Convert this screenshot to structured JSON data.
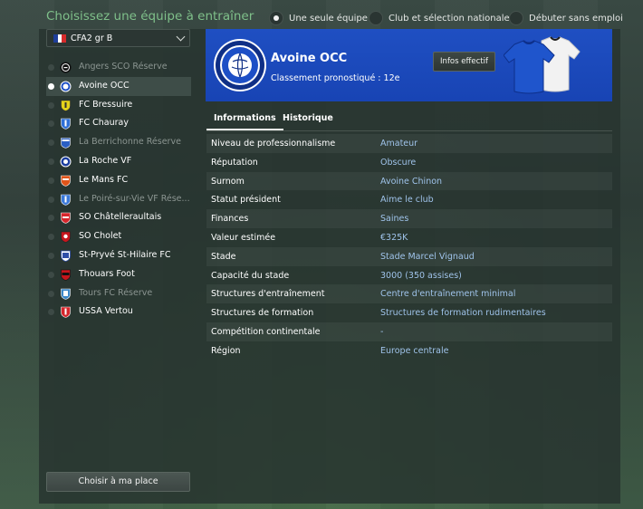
{
  "page_title": "Choisissez une équipe à entraîner",
  "mode_options": [
    {
      "label": "Une seule équipe",
      "selected": true
    },
    {
      "label": "Club et sélection nationale",
      "selected": false
    },
    {
      "label": "Débuter sans emploi",
      "selected": false
    }
  ],
  "division": {
    "label": "CFA2 gr B",
    "flag": "france-flag"
  },
  "teams": [
    {
      "name": "Angers SCO Réserve",
      "dim": true,
      "selected": false,
      "crest_color": "#111111"
    },
    {
      "name": "Avoine OCC",
      "dim": false,
      "selected": true,
      "crest_color": "#1d4fc6"
    },
    {
      "name": "FC Bressuire",
      "dim": false,
      "selected": false,
      "crest_color": "#e4d31a"
    },
    {
      "name": "FC Chauray",
      "dim": false,
      "selected": false,
      "crest_color": "#2e6fd6"
    },
    {
      "name": "La Berrichonne Réserve",
      "dim": true,
      "selected": false,
      "crest_color": "#2a5fc4"
    },
    {
      "name": "La Roche VF",
      "dim": false,
      "selected": false,
      "crest_color": "#1c3ea0"
    },
    {
      "name": "Le Mans FC",
      "dim": false,
      "selected": false,
      "crest_color": "#e0541a"
    },
    {
      "name": "Le Poiré-sur-Vie VF Rése...",
      "dim": true,
      "selected": false,
      "crest_color": "#3a78d8"
    },
    {
      "name": "SO Châtelleraultais",
      "dim": false,
      "selected": false,
      "crest_color": "#d7262c"
    },
    {
      "name": "SO Cholet",
      "dim": false,
      "selected": false,
      "crest_color": "#c7161d"
    },
    {
      "name": "St-Pryvé St-Hilaire FC",
      "dim": false,
      "selected": false,
      "crest_color": "#2f4ea8"
    },
    {
      "name": "Thouars Foot",
      "dim": false,
      "selected": false,
      "crest_color": "#c4161c"
    },
    {
      "name": "Tours FC Réserve",
      "dim": true,
      "selected": false,
      "crest_color": "#3a87c8"
    },
    {
      "name": "USSA Vertou",
      "dim": false,
      "selected": false,
      "crest_color": "#d4252b"
    }
  ],
  "choose_button": "Choisir à ma place",
  "club": {
    "name": "Avoine OCC",
    "rank": "Classement pronostiqué : 12e",
    "squad_button": "Infos effectif",
    "color": "#1d4fc6"
  },
  "tabs": [
    {
      "label": "Informations",
      "active": true
    },
    {
      "label": "Historique",
      "active": false
    }
  ],
  "info": [
    {
      "label": "Niveau de professionnalisme",
      "value": "Amateur"
    },
    {
      "label": "Réputation",
      "value": "Obscure"
    },
    {
      "label": "Surnom",
      "value": "Avoine Chinon"
    },
    {
      "label": "Statut président",
      "value": "Aime le club"
    },
    {
      "label": "Finances",
      "value": "Saines"
    },
    {
      "label": "Valeur estimée",
      "value": "€325K"
    },
    {
      "label": "Stade",
      "value": "Stade Marcel Vignaud"
    },
    {
      "label": "Capacité du stade",
      "value": "3000 (350 assises)"
    },
    {
      "label": "Structures d'entraînement",
      "value": "Centre d'entraînement minimal"
    },
    {
      "label": "Structures de formation",
      "value": "Structures de formation rudimentaires"
    },
    {
      "label": "Compétition continentale",
      "value": "-"
    },
    {
      "label": "Région",
      "value": "Europe centrale"
    }
  ]
}
